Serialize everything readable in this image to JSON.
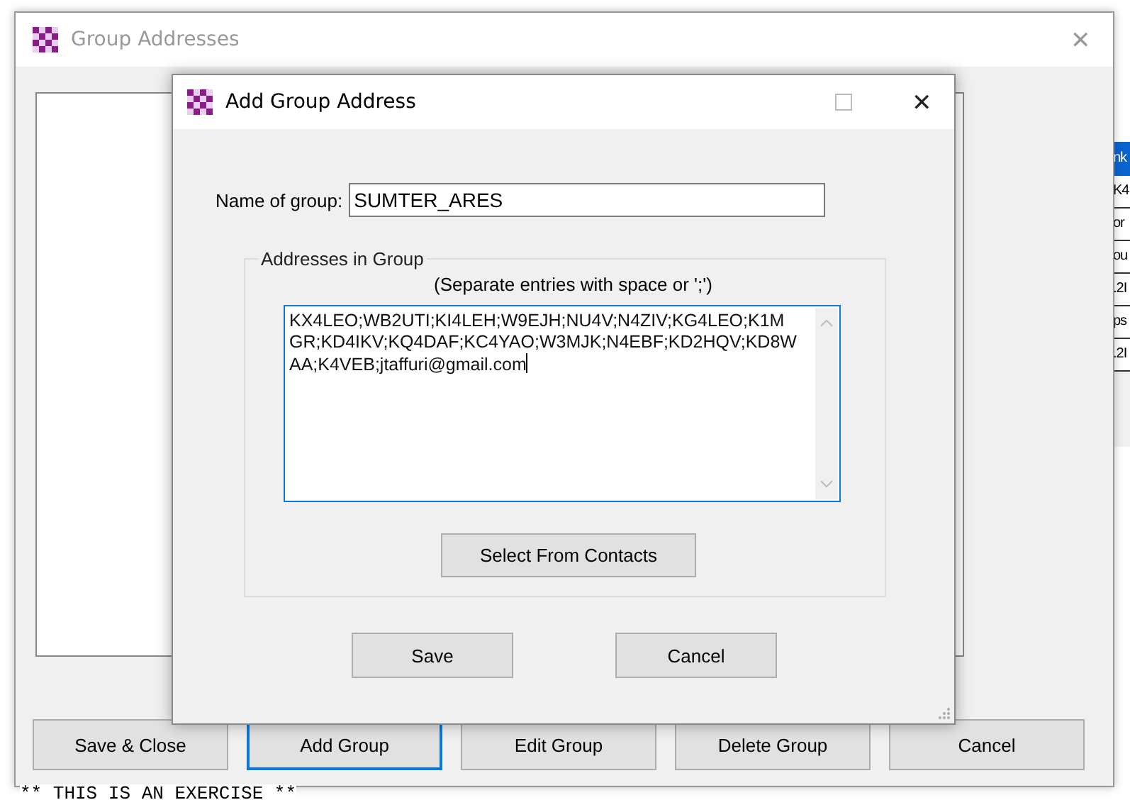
{
  "main_window": {
    "title": "Group Addresses",
    "close": "✕",
    "buttons": [
      {
        "label": "Save & Close",
        "focused": false
      },
      {
        "label": "Add Group",
        "focused": true
      },
      {
        "label": "Edit Group",
        "focused": false
      },
      {
        "label": "Delete Group",
        "focused": false
      },
      {
        "label": "Cancel",
        "focused": false
      }
    ],
    "footer": "** THIS IS AN EXERCISE **"
  },
  "side_grid": {
    "header": "nk",
    "cells": [
      "K4",
      "or",
      "ou",
      ".2I",
      "ps",
      ".2I"
    ]
  },
  "dialog": {
    "title": "Add Group Address",
    "close": "✕",
    "name_label": "Name of group:",
    "name_value": "SUMTER_ARES",
    "group_title": "Addresses in Group",
    "hint": "(Separate entries with space or ';')",
    "addresses": "KX4LEO;WB2UTI;KI4LEH;W9EJH;NU4V;N4ZIV;KG4LEO;K1MGR;KD4IKV;KQ4DAF;KC4YAO;W3MJK;N4EBF;KD2HQV;KD8WAA;K4VEB;jtaffuri@gmail.com",
    "select_button": "Select From Contacts",
    "buttons": [
      "Save",
      "Cancel"
    ]
  }
}
